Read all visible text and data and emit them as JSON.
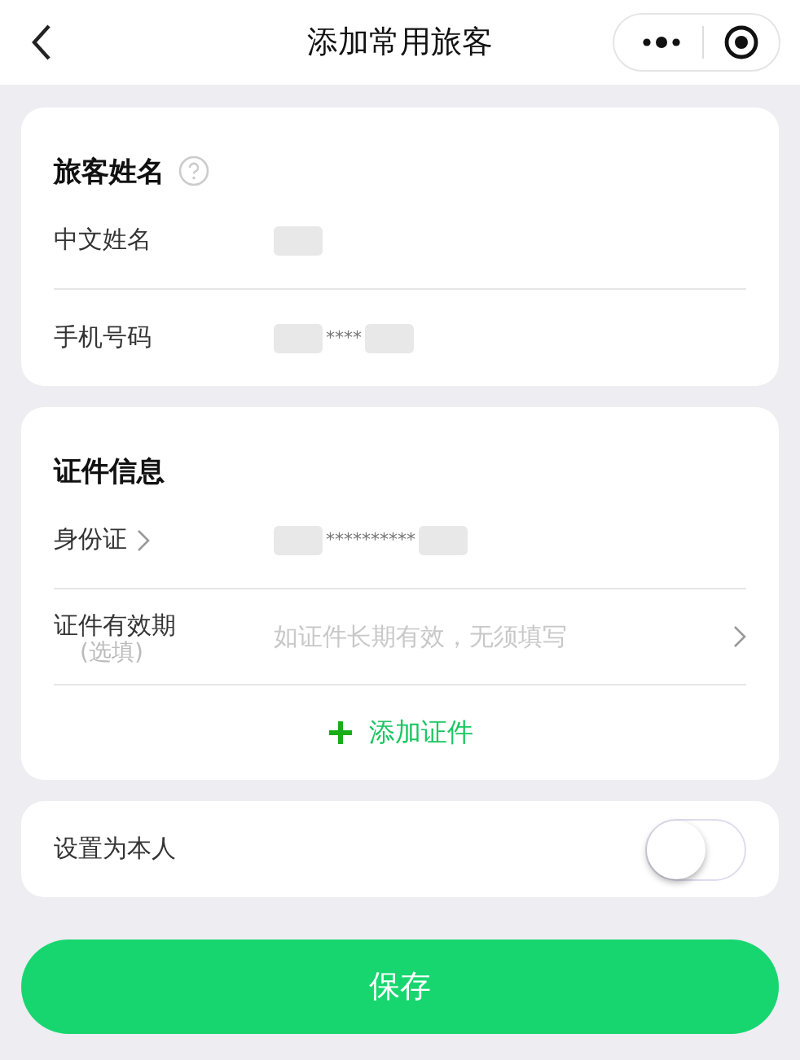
{
  "nav": {
    "title": "添加常用旅客"
  },
  "name_card": {
    "heading": "旅客姓名",
    "rows": [
      {
        "label": "中文姓名"
      },
      {
        "label": "手机号码",
        "value": "****"
      }
    ]
  },
  "id_card": {
    "heading": "证件信息",
    "id_row": {
      "label": "身份证",
      "value": "**********"
    },
    "validity_row": {
      "label": "证件有效期",
      "note": "(选填)",
      "placeholder": "如证件长期有效，无须填写"
    },
    "add_label": "添加证件"
  },
  "self_row": {
    "label": "设置为本人",
    "on": false
  },
  "save_button": "保存"
}
